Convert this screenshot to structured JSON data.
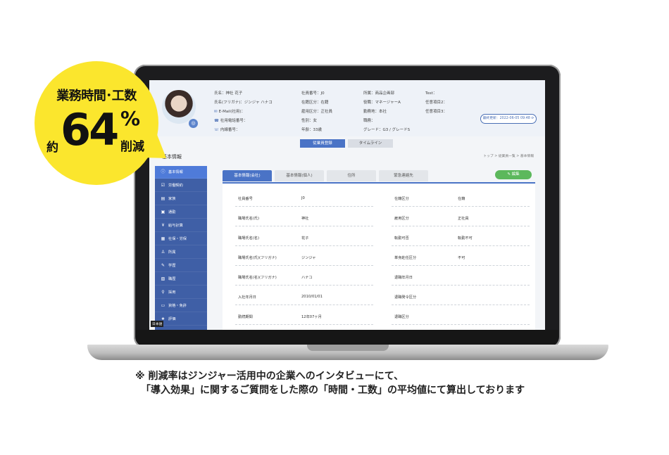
{
  "callout": {
    "line1": "業務時間･工数",
    "prefix": "約",
    "number": "64",
    "percent": "%",
    "suffix": "削減"
  },
  "profile": {
    "name": "氏名：神社 花子",
    "kana": "氏名(フリガナ)：ジンジャ ハナコ",
    "email": "E-Mail(社用)：",
    "phone": "社用電話番号：",
    "ext": "内線番号：",
    "emp_no": "社員番号：J0",
    "status": "在籍区分：在籍",
    "emp_type": "雇用区分：正社員",
    "gender": "性別：女",
    "age": "年齢：33歳",
    "dept": "所属：商品企画部",
    "role": "役職：マネージャーA",
    "location": "勤務地：本社",
    "job": "職務：",
    "grade": "グレード：G3 / グレードS",
    "test": "Test：",
    "free2": "任意項目2：",
    "free3": "任意項目3：",
    "updated": "最終更新：2022-06-05 09:48 ⟳",
    "avatar_badge": "◎"
  },
  "top_tabs": [
    "従業員登録",
    "タイムライン"
  ],
  "section_title": "基本情報",
  "breadcrumb": "トップ > 従業員一覧 > 基本情報",
  "sidebar": {
    "items": [
      {
        "icon": "ⓘ",
        "label": "基本情報"
      },
      {
        "icon": "☑",
        "label": "労働契約"
      },
      {
        "icon": "▤",
        "label": "家族"
      },
      {
        "icon": "▣",
        "label": "通勤"
      },
      {
        "icon": "¥",
        "label": "給与計算"
      },
      {
        "icon": "▦",
        "label": "社保・労保"
      },
      {
        "icon": "♙",
        "label": "所属"
      },
      {
        "icon": "✎",
        "label": "学歴"
      },
      {
        "icon": "▧",
        "label": "職歴"
      },
      {
        "icon": "⚲",
        "label": "採用"
      },
      {
        "icon": "▭",
        "label": "資格・免許"
      },
      {
        "icon": "★",
        "label": "評価"
      }
    ],
    "lang": "日本語"
  },
  "content_tabs": [
    "基本情報(会社)",
    "基本情報(個人)",
    "住所",
    "緊急連絡先"
  ],
  "edit_label": "✎ 編集",
  "rows": [
    {
      "l1": "社員番号",
      "v1": "J0",
      "l2": "在籍区分",
      "v2": "在籍"
    },
    {
      "l1": "職場氏名(氏)",
      "v1": "神社",
      "l2": "雇用区分",
      "v2": "正社員"
    },
    {
      "l1": "職場氏名(名)",
      "v1": "花子",
      "l2": "転勤可否",
      "v2": "転勤不可"
    },
    {
      "l1": "職場氏名(氏)(フリガナ)",
      "v1": "ジンジャ",
      "l2": "単身赴任区分",
      "v2": "不可"
    },
    {
      "l1": "職場氏名(名)(フリガナ)",
      "v1": "ハナコ",
      "l2": "退職年月日",
      "v2": ""
    },
    {
      "l1": "入社年月日",
      "v1": "2010/01/01",
      "l2": "退職発令区分",
      "v2": ""
    },
    {
      "l1": "勤続期間",
      "v1": "12年07ヶ月",
      "l2": "退職区分",
      "v2": ""
    }
  ],
  "note": {
    "line1": "※ 削減率はジンジャー活用中の企業へのインタビューにて、",
    "line2": "「導入効果」に関するご質問をした際の「時間・工数」の平均値にて算出しております"
  }
}
